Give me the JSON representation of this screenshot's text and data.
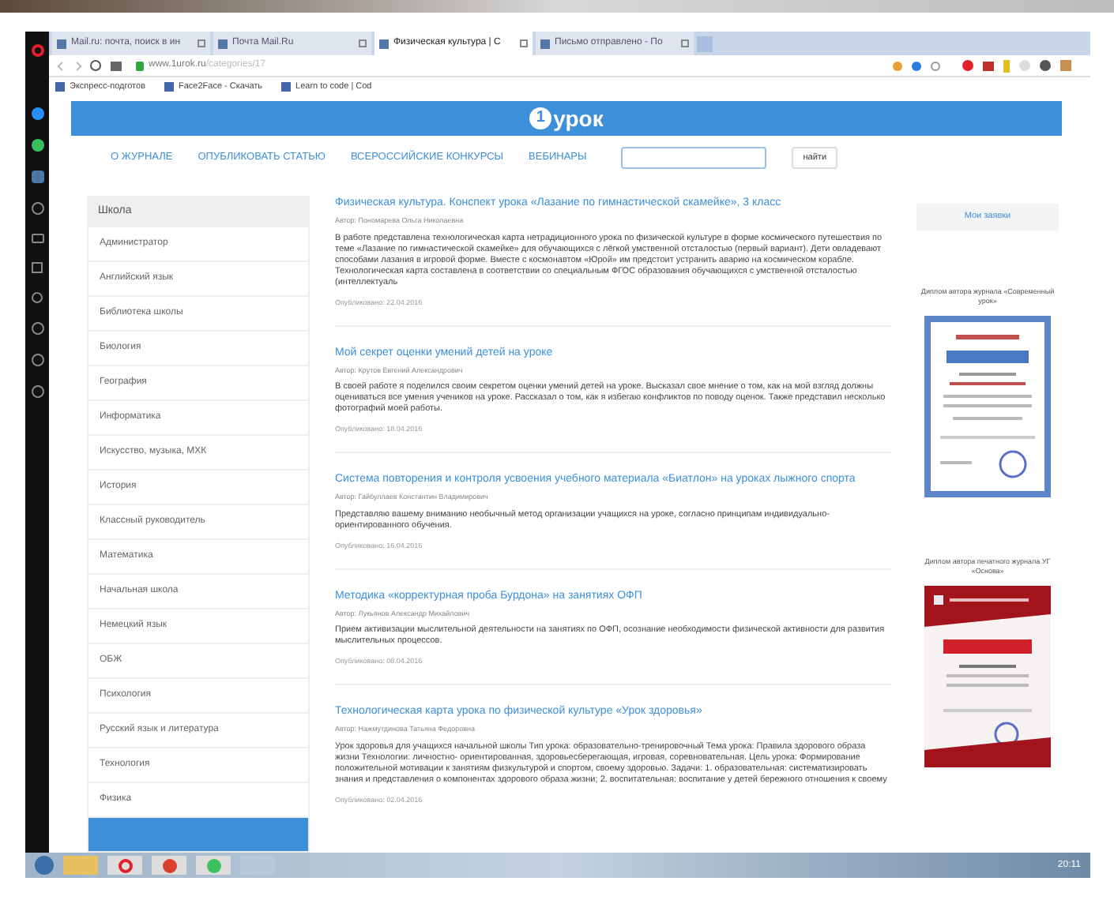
{
  "browser": {
    "tabs": [
      {
        "label": "Mail.ru: почта, поиск в ин",
        "selected": false
      },
      {
        "label": "Почта Mail.Ru",
        "selected": false
      },
      {
        "label": "Физическая культура | С",
        "selected": true
      },
      {
        "label": "Письмо отправлено - По",
        "selected": false
      }
    ],
    "url": {
      "host": "www.1urok.ru",
      "path": "/categories/17"
    },
    "bookmarks": [
      "Экспресс-подготов",
      "Face2Face - Скачать",
      "Learn to code | Cod"
    ]
  },
  "site": {
    "logo": {
      "mark": "1",
      "text": "урок"
    },
    "nav": [
      "О ЖУРНАЛЕ",
      "ОПУБЛИКОВАТЬ СТАТЬЮ",
      "ВСЕРОССИЙСКИЕ КОНКУРСЫ",
      "ВЕБИНАРЫ"
    ],
    "search_button": "найти"
  },
  "sidebar": {
    "title": "Школа",
    "items": [
      {
        "label": "Администратор",
        "selected": false
      },
      {
        "label": "Английский язык",
        "selected": false
      },
      {
        "label": "Библиотека школы",
        "selected": false
      },
      {
        "label": "Биология",
        "selected": false
      },
      {
        "label": "География",
        "selected": false
      },
      {
        "label": "Информатика",
        "selected": false
      },
      {
        "label": "Искусство, музыка, МХК",
        "selected": false
      },
      {
        "label": "История",
        "selected": false
      },
      {
        "label": "Классный руководитель",
        "selected": false
      },
      {
        "label": "Математика",
        "selected": false
      },
      {
        "label": "Начальная школа",
        "selected": false
      },
      {
        "label": "Немецкий язык",
        "selected": false
      },
      {
        "label": "ОБЖ",
        "selected": false
      },
      {
        "label": "Психология",
        "selected": false
      },
      {
        "label": "Русский язык и литература",
        "selected": false
      },
      {
        "label": "Технология",
        "selected": false
      },
      {
        "label": "Физика",
        "selected": false
      },
      {
        "selected": true
      }
    ]
  },
  "articles": [
    {
      "title": "Физическая культура. Конспект урока «Лазание по гимнастической скамейке», 3 класс",
      "author": "Автор: Пономарева Ольга Николаевна",
      "text": "В работе представлена технологическая карта нетрадиционного урока по физической культуре в форме космического путешествия по теме «Лазание по гимнастической скамейке» для обучающихся с лёгкой умственной отсталостью (первый вариант). Дети овладевают способами лазания в игровой форме. Вместе с космонавтом «Юрой» им предстоит устранить аварию на космическом корабле. Технологическая карта составлена в соответствии со специальным ФГОС образования обучающихся с умственной отсталостью (интеллектуаль",
      "date": "Опубликовано: 22.04.2016"
    },
    {
      "title": "Мой секрет оценки умений детей на уроке",
      "author": "Автор: Крутов Евгений Александрович",
      "text": "В своей работе я поделился своим секретом оценки умений детей на уроке. Высказал свое мнение о том, как на мой взгляд должны оцениваться все умения учеников на уроке. Рассказал о том, как я избегаю конфликтов по поводу оценок. Также представил несколько фотографий моей работы.",
      "date": "Опубликовано: 18.04.2016"
    },
    {
      "title": "Система повторения и контроля усвоения учебного материала «Биатлон» на уроках лыжного спорта",
      "author": "Автор: Гайбуллаев Константин Владимирович",
      "text": "Представляю вашему вниманию необычный метод организации учащихся на уроке, согласно принципам индивидуально-ориентированного обучения.",
      "date": "Опубликовано: 16.04.2016"
    },
    {
      "title": "Методика «корректурная проба Бурдона» на занятиях ОФП",
      "author": "Автор: Лукьянов Александр Михайлович",
      "text": "Прием активизации мыслительной деятельности на занятиях по ОФП, осознание необходимости физической активности для развития мыслительных процессов.",
      "date": "Опубликовано: 08.04.2016"
    },
    {
      "title": "Технологическая карта урока по физической культуре «Урок здоровья»",
      "author": "Автор: Нажмутдинова Татьяна Федоровна",
      "text": "Урок здоровья для учащихся начальной школы Тип урока: образовательно-тренировочный Тема урока: Правила здорового образа жизни Технологии: личностно- ориентированная, здоровьесберегающая, игровая, соревновательная. Цель урока: Формирование положительной мотивации к занятиям физкультурой и спортом, своему здоровью. Задачи: 1. образовательная: систематизировать знания и представления о компонентах здорового образа жизни; 2. воспитательная: воспитание у детей бережного отношения к своему",
      "date": "Опубликовано: 02.04.2016"
    }
  ],
  "right_column": {
    "button": "Мои заявки",
    "diplomas": [
      {
        "caption": "Диплом автора журнала «Современный урок»",
        "kind": "blue"
      },
      {
        "caption": "Диплом автора печатного журнала УГ «Основа»",
        "kind": "red"
      }
    ]
  },
  "taskbar": {
    "clock": "20:11"
  }
}
